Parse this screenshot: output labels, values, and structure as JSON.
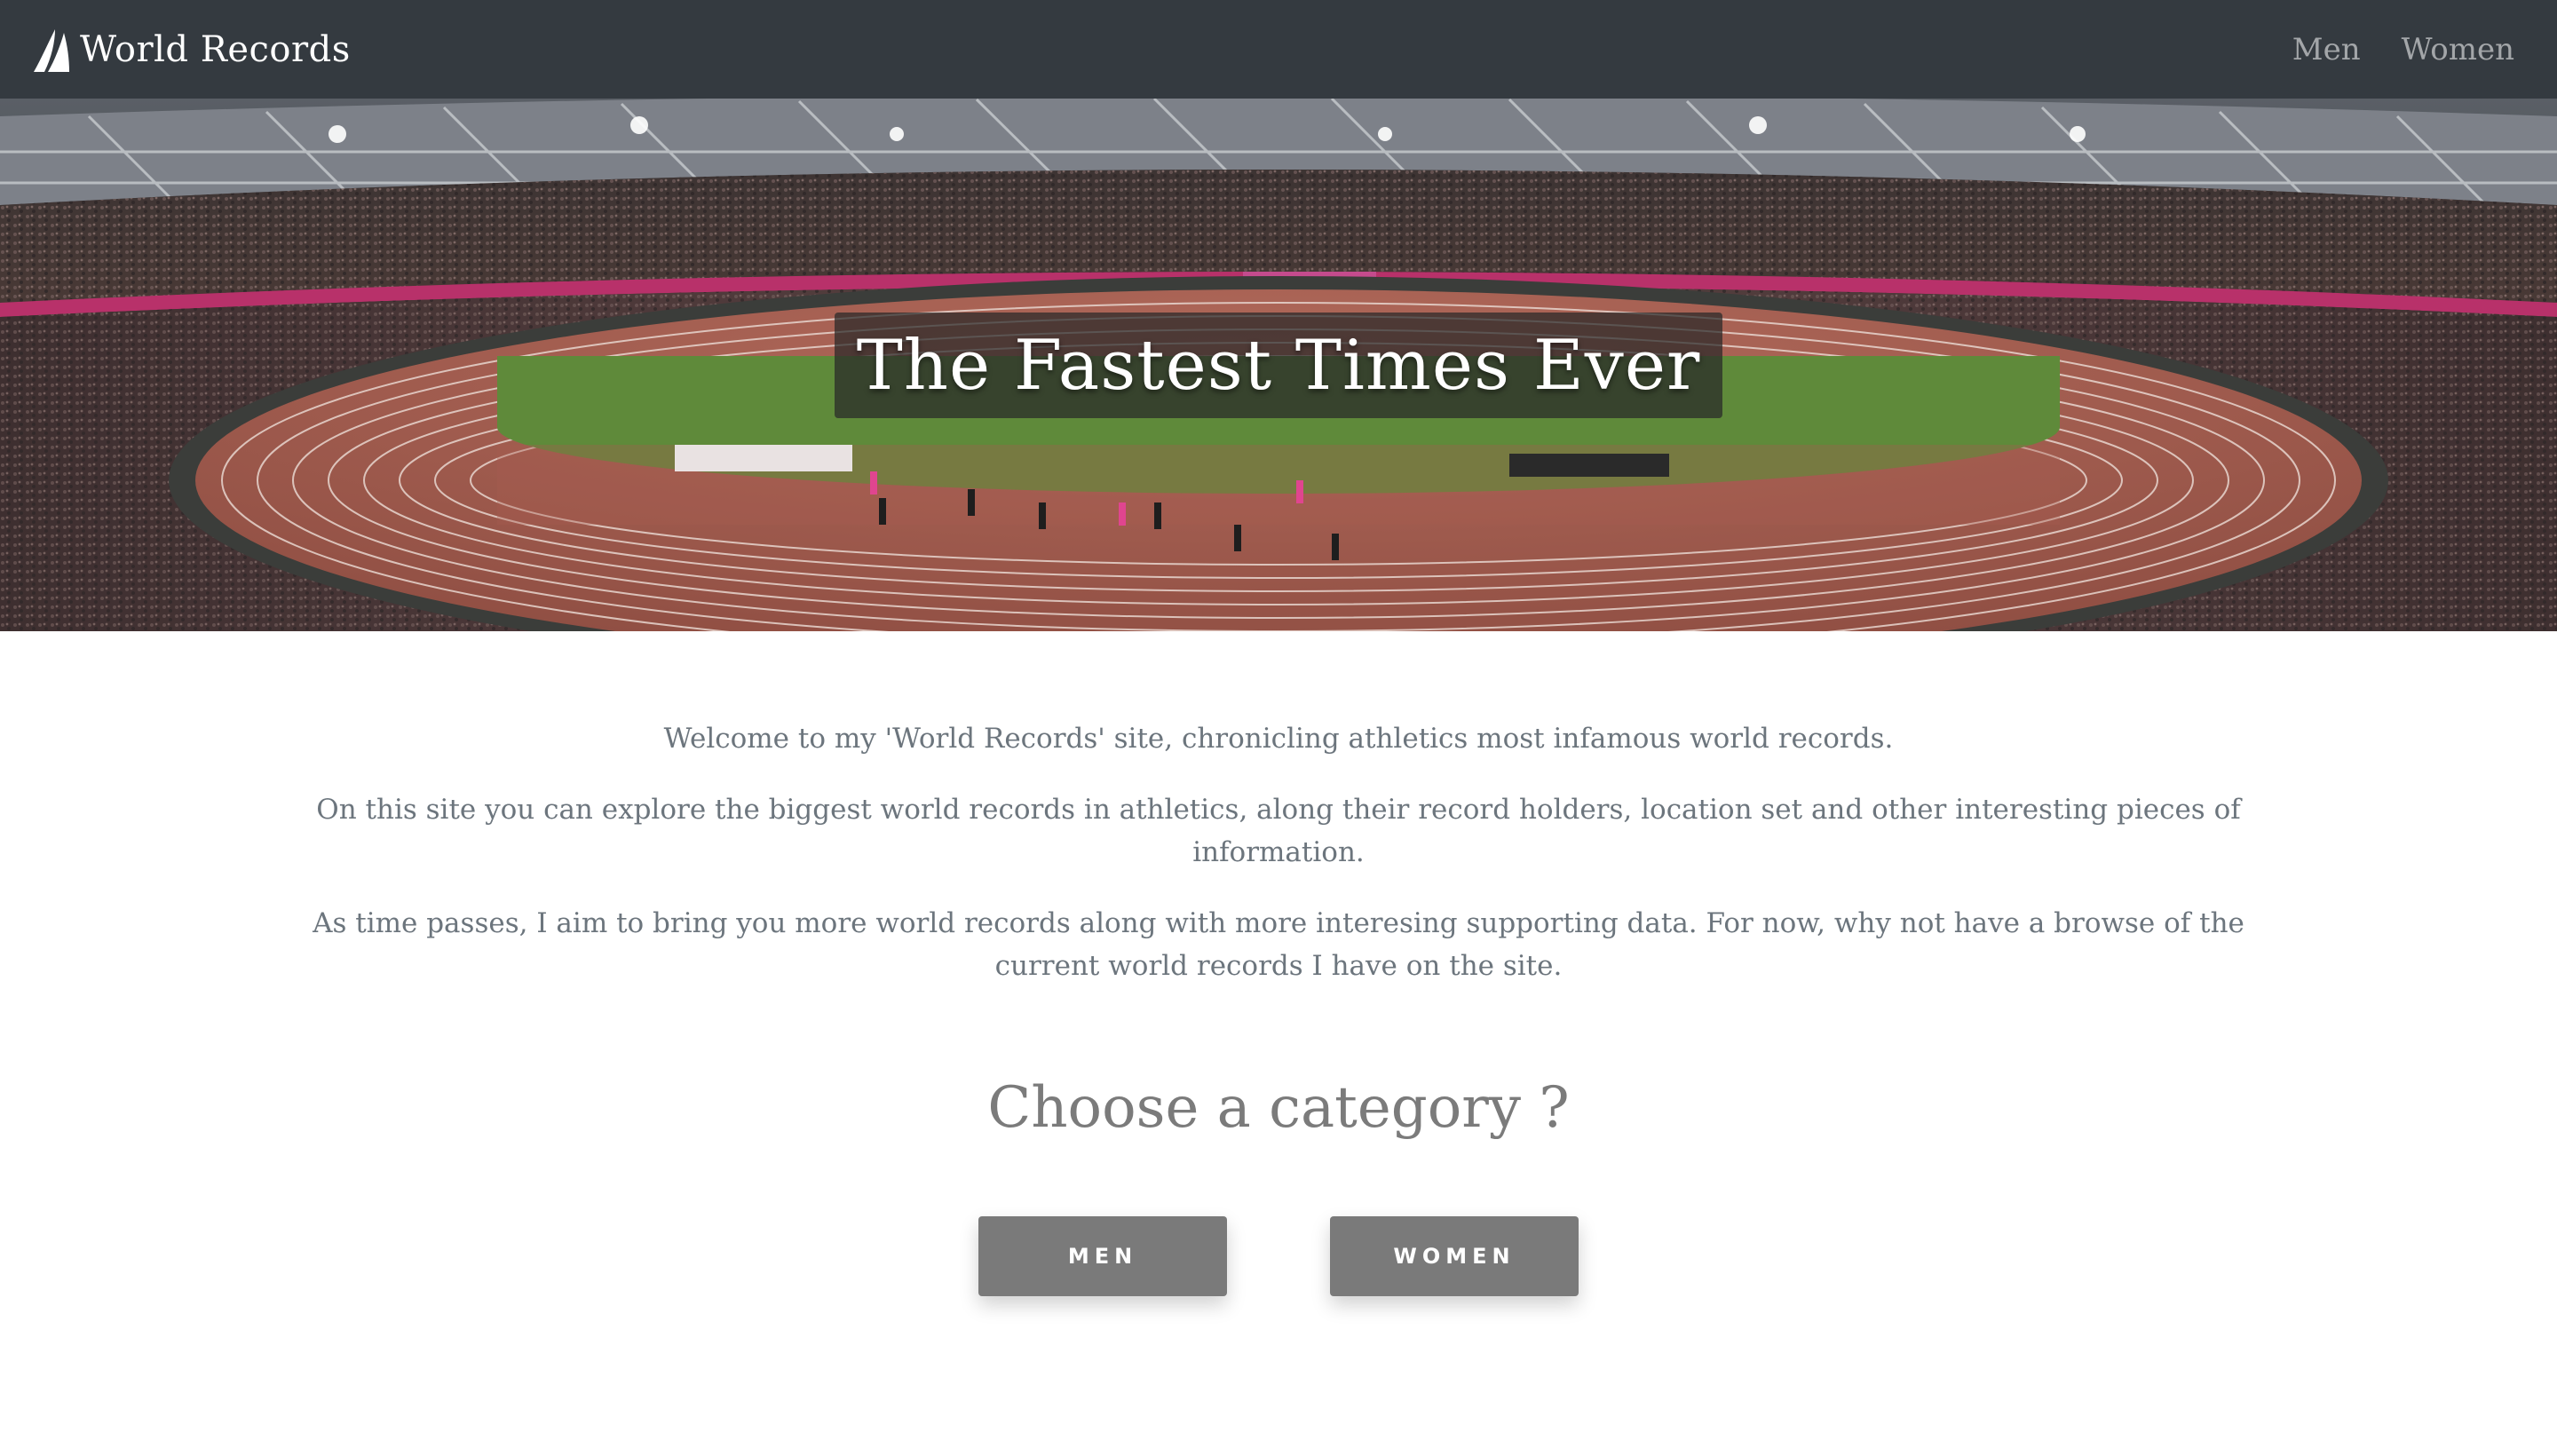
{
  "navbar": {
    "brand": "World Records",
    "links": [
      "Men",
      "Women"
    ]
  },
  "hero": {
    "title": "The Fastest Times Ever"
  },
  "intro": {
    "p1": "Welcome to my 'World Records' site, chronicling athletics most infamous world records.",
    "p2": "On this site you can explore the biggest world records in athletics, along their record holders, location set and other interesting pieces of information.",
    "p3": "As time passes, I aim to bring you more world records along with more interesing supporting data. For now, why not have a browse of the current world records I have on the site."
  },
  "category": {
    "heading": "Choose a category ?",
    "buttons": [
      "MEN",
      "WOMEN"
    ]
  },
  "colors": {
    "navbar": "#343a40",
    "text_muted": "#6c757d",
    "button": "#7a7a7a"
  }
}
